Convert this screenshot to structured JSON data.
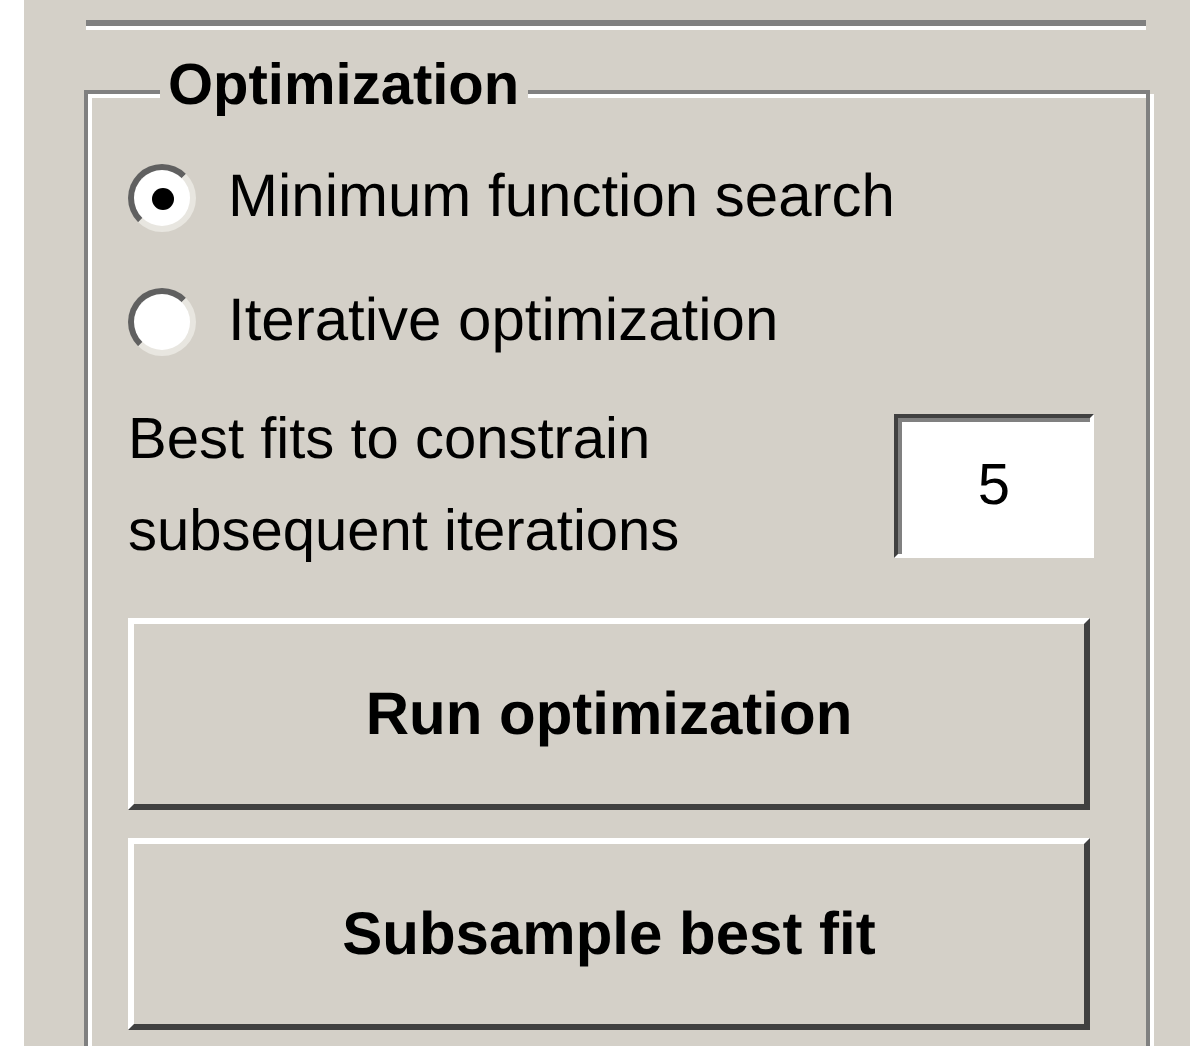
{
  "group": {
    "title": "Optimization"
  },
  "options": [
    {
      "label": "Minimum function search",
      "selected": true
    },
    {
      "label": "Iterative optimization",
      "selected": false
    }
  ],
  "best_fits": {
    "label": "Best fits to constrain subsequent iterations",
    "value": "5"
  },
  "buttons": [
    "Run optimization",
    "Subsample best fit"
  ]
}
